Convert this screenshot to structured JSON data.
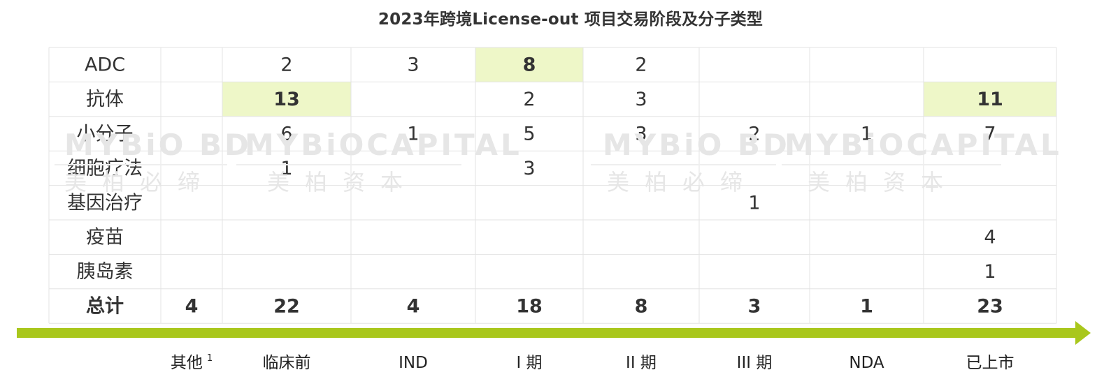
{
  "title": "2023年跨境License-out 项目交易阶段及分子类型",
  "watermark": {
    "logos": [
      "MYBiO BD",
      "MYBiOCAPITAL",
      "MYBiO BD",
      "MYBiOCAPITAL"
    ],
    "cn": [
      "美柏必缔",
      "美柏资本",
      "美柏必缔",
      "美柏资本"
    ]
  },
  "colors": {
    "highlight": "#eef7c8",
    "arrow": "#a9c71c",
    "grid": "#e3e3e3",
    "text": "#333333"
  },
  "chart_data": {
    "type": "table",
    "title": "2023年跨境License-out 项目交易阶段及分子类型",
    "columns": [
      "其他",
      "临床前",
      "IND",
      "I 期",
      "II 期",
      "III 期",
      "NDA",
      "已上市"
    ],
    "column_footnotes": [
      "1",
      "",
      "",
      "",
      "",
      "",
      "",
      ""
    ],
    "rows": [
      {
        "label": "ADC",
        "values": [
          null,
          2,
          3,
          8,
          2,
          null,
          null,
          null
        ],
        "highlight": [
          false,
          false,
          false,
          true,
          false,
          false,
          false,
          false
        ]
      },
      {
        "label": "抗体",
        "values": [
          null,
          13,
          null,
          2,
          3,
          null,
          null,
          11
        ],
        "highlight": [
          false,
          true,
          false,
          false,
          false,
          false,
          false,
          true
        ]
      },
      {
        "label": "小分子",
        "values": [
          null,
          6,
          1,
          5,
          3,
          2,
          1,
          7
        ],
        "highlight": [
          false,
          false,
          false,
          false,
          false,
          false,
          false,
          false
        ]
      },
      {
        "label": "细胞疗法",
        "values": [
          null,
          1,
          null,
          3,
          null,
          null,
          null,
          null
        ],
        "highlight": [
          false,
          false,
          false,
          false,
          false,
          false,
          false,
          false
        ]
      },
      {
        "label": "基因治疗",
        "values": [
          null,
          null,
          null,
          null,
          null,
          1,
          null,
          null
        ],
        "highlight": [
          false,
          false,
          false,
          false,
          false,
          false,
          false,
          false
        ]
      },
      {
        "label": "疫苗",
        "values": [
          null,
          null,
          null,
          null,
          null,
          null,
          null,
          4
        ],
        "highlight": [
          false,
          false,
          false,
          false,
          false,
          false,
          false,
          false
        ]
      },
      {
        "label": "胰岛素",
        "values": [
          null,
          null,
          null,
          null,
          null,
          null,
          null,
          1
        ],
        "highlight": [
          false,
          false,
          false,
          false,
          false,
          false,
          false,
          false
        ]
      }
    ],
    "total": {
      "label": "总计",
      "values": [
        4,
        22,
        4,
        18,
        8,
        3,
        1,
        23
      ]
    }
  }
}
